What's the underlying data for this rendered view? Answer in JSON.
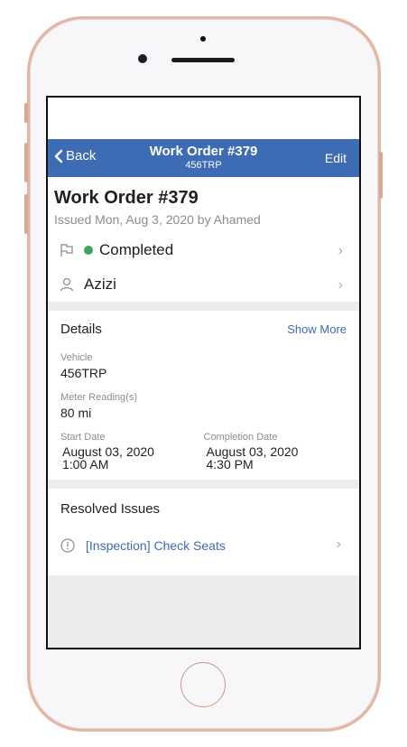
{
  "nav": {
    "back_label": "Back",
    "title": "Work Order #379",
    "subtitle": "456TRP",
    "edit_label": "Edit"
  },
  "header": {
    "title": "Work Order #379",
    "issued": "Issued Mon, Aug 3, 2020 by Ahamed"
  },
  "status": {
    "label": "Completed",
    "color": "#3aa756"
  },
  "assignee": {
    "name": "Azizi"
  },
  "details": {
    "title": "Details",
    "show_more": "Show More",
    "vehicle_label": "Vehicle",
    "vehicle_value": "456TRP",
    "meter_label": "Meter Reading(s)",
    "meter_value": "80 mi",
    "start_label": "Start Date",
    "start_date": "August 03, 2020",
    "start_time": "1:00 AM",
    "completion_label": "Completion Date",
    "completion_date": "August 03, 2020",
    "completion_time": "4:30 PM"
  },
  "resolved": {
    "title": "Resolved Issues",
    "issues": [
      {
        "label": "[Inspection] Check Seats"
      }
    ]
  },
  "colors": {
    "accent": "#3d6bb4",
    "phone_frame": "#e8b49f"
  }
}
